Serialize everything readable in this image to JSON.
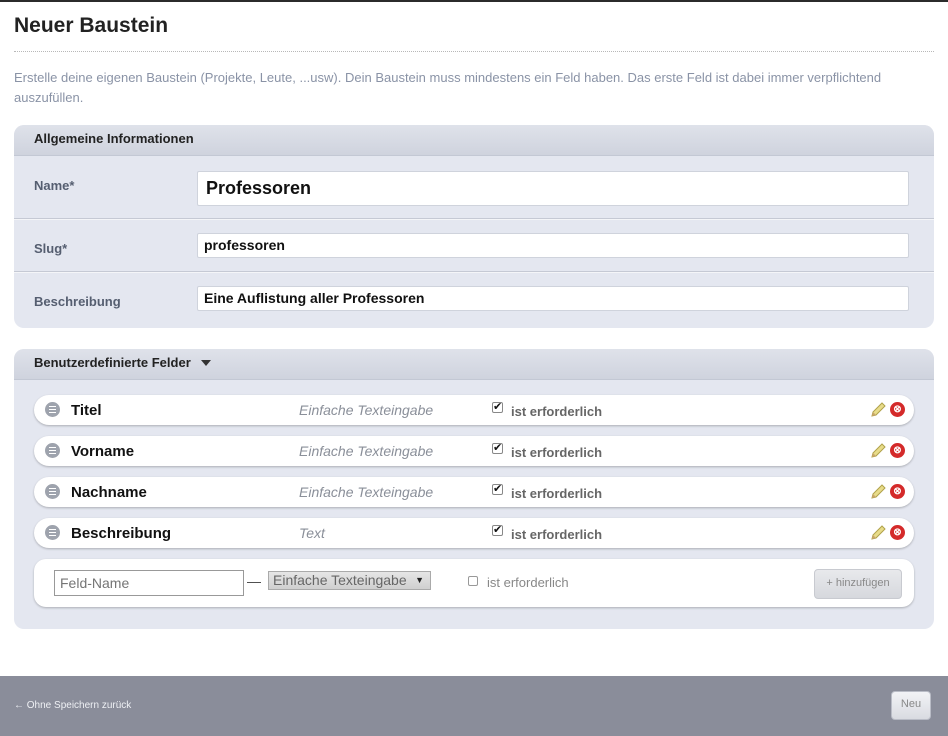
{
  "page": {
    "title": "Neuer Baustein",
    "intro": "Erstelle deine eigenen Baustein (Projekte, Leute, ...usw). Dein Baustein muss mindestens ein Feld haben. Das erste Feld ist dabei immer verpflichtend auszufüllen."
  },
  "general": {
    "heading": "Allgemeine Informationen",
    "name_label": "Name*",
    "name_value": "Professoren",
    "slug_label": "Slug*",
    "slug_value": "professoren",
    "desc_label": "Beschreibung",
    "desc_value": "Eine Auflistung aller Professoren"
  },
  "custom": {
    "heading": "Benutzerdefinierte Felder",
    "fields": [
      {
        "name": "Titel",
        "type": "Einfache Texteingabe",
        "required": true,
        "required_label": "ist erforderlich"
      },
      {
        "name": "Vorname",
        "type": "Einfache Texteingabe",
        "required": true,
        "required_label": "ist erforderlich"
      },
      {
        "name": "Nachname",
        "type": "Einfache Texteingabe",
        "required": true,
        "required_label": "ist erforderlich"
      },
      {
        "name": "Beschreibung",
        "type": "Text",
        "required": true,
        "required_label": "ist erforderlich"
      }
    ],
    "add": {
      "name_placeholder": "Feld-Name",
      "separator": "—",
      "type_selected": "Einfache Texteingabe",
      "required": false,
      "required_label": "ist erforderlich",
      "button_label": "+ hinzufügen"
    }
  },
  "footer": {
    "back_label": "← Ohne Speichern zurück",
    "new_label": "Neu"
  },
  "colors": {
    "panel_bg": "#e4e7f0",
    "footer_bg": "#8a8d9a",
    "delete": "#d42a2a"
  }
}
